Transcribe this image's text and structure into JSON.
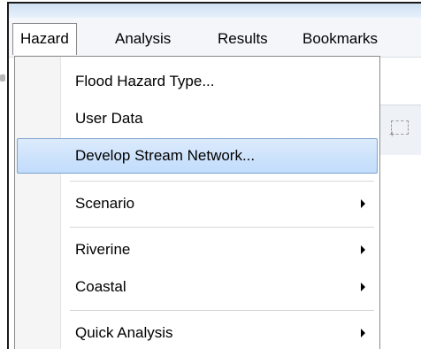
{
  "menubar": {
    "items": [
      {
        "label": "Hazard",
        "active": true
      },
      {
        "label": "Analysis",
        "active": false
      },
      {
        "label": "Results",
        "active": false
      },
      {
        "label": "Bookmarks",
        "active": false
      }
    ]
  },
  "hazard_menu": {
    "items": [
      {
        "label": "Flood Hazard Type...",
        "submenu": false,
        "highlighted": false
      },
      {
        "label": "User Data",
        "submenu": false,
        "highlighted": false
      },
      {
        "label": "Develop Stream Network...",
        "submenu": false,
        "highlighted": true
      },
      {
        "label": "Scenario",
        "submenu": true,
        "highlighted": false
      },
      {
        "label": "Riverine",
        "submenu": true,
        "highlighted": false
      },
      {
        "label": "Coastal",
        "submenu": true,
        "highlighted": false
      },
      {
        "label": "Quick Analysis",
        "submenu": true,
        "highlighted": false
      }
    ]
  },
  "colors": {
    "highlight_fill": "#c8e0fc",
    "highlight_border": "#7da2ce",
    "menu_border": "#8a8a8a"
  },
  "icons": {
    "toolbar_partial": "select-polygon-icon",
    "submenu": "triangle-right-icon"
  }
}
